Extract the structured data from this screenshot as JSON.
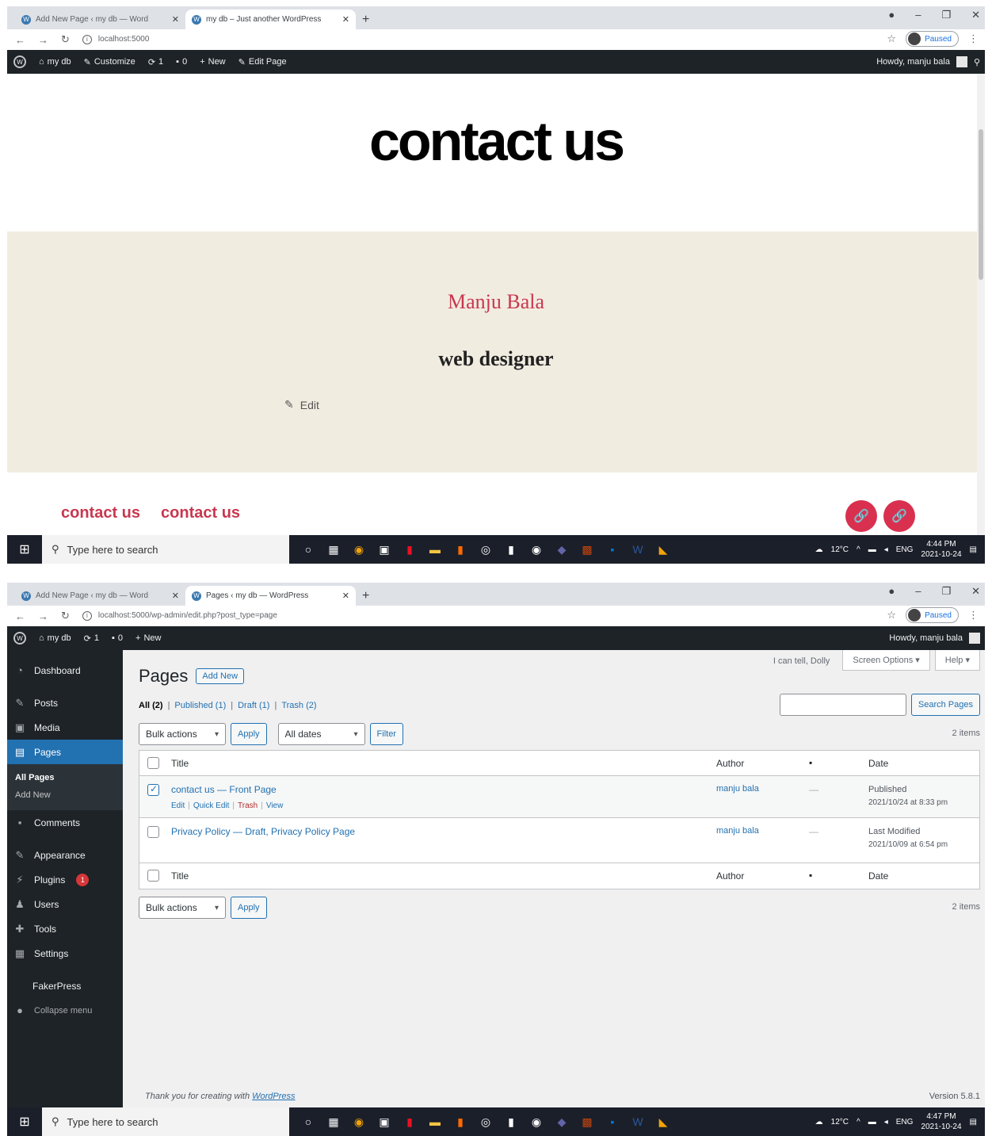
{
  "shot1": {
    "tabs": [
      {
        "label": "Add New Page ‹ my db — Word",
        "active": false
      },
      {
        "label": "my db – Just another WordPress",
        "active": true
      }
    ],
    "url": "localhost:5000",
    "profile_label": "Paused",
    "adminbar": {
      "site": "my db",
      "customize": "Customize",
      "updates": "1",
      "comments": "0",
      "new": "New",
      "edit_page": "Edit Page",
      "howdy": "Howdy, manju bala"
    },
    "page": {
      "title": "contact us",
      "name": "Manju Bala",
      "role": "web designer",
      "edit": "Edit",
      "footer_links": [
        "contact us",
        "contact us"
      ]
    }
  },
  "shot2": {
    "tabs": [
      {
        "label": "Add New Page ‹ my db — Word",
        "active": false
      },
      {
        "label": "Pages ‹ my db — WordPress",
        "active": true
      }
    ],
    "url": "localhost:5000/wp-admin/edit.php?post_type=page",
    "profile_label": "Paused",
    "adminbar": {
      "site": "my db",
      "updates": "1",
      "comments": "0",
      "new": "New",
      "howdy": "Howdy, manju bala"
    },
    "sidebar": {
      "dashboard": "Dashboard",
      "posts": "Posts",
      "media": "Media",
      "pages": "Pages",
      "all_pages": "All Pages",
      "add_new": "Add New",
      "comments": "Comments",
      "appearance": "Appearance",
      "plugins": "Plugins",
      "plugins_badge": "1",
      "users": "Users",
      "tools": "Tools",
      "settings": "Settings",
      "fakerpress": "FakerPress",
      "collapse": "Collapse menu"
    },
    "dolly": "I can tell, Dolly",
    "screen_options": "Screen Options ▾",
    "help": "Help ▾",
    "heading": "Pages",
    "add_new_btn": "Add New",
    "filters": {
      "all": "All (2)",
      "published": "Published (1)",
      "draft": "Draft (1)",
      "trash": "Trash (2)"
    },
    "search_btn": "Search Pages",
    "bulk_actions": "Bulk actions",
    "apply": "Apply",
    "all_dates": "All dates",
    "filter": "Filter",
    "items_count": "2 items",
    "columns": {
      "title": "Title",
      "author": "Author",
      "date": "Date"
    },
    "rows": [
      {
        "title": "contact us — Front Page",
        "author": "manju bala",
        "comments": "—",
        "status": "Published",
        "date": "2021/10/24 at 8:33 pm",
        "checked": true,
        "actions": [
          "Edit",
          "Quick Edit",
          "Trash",
          "View"
        ]
      },
      {
        "title": "Privacy Policy — Draft, Privacy Policy Page",
        "author": "manju bala",
        "comments": "—",
        "status": "Last Modified",
        "date": "2021/10/09 at 6:54 pm",
        "checked": false
      }
    ],
    "footer_thanks": "Thank you for creating with",
    "footer_link": "WordPress",
    "version": "Version 5.8.1"
  },
  "taskbar": {
    "search_placeholder": "Type here to search",
    "temp": "12°C",
    "lang": "ENG",
    "time1": "4:44 PM",
    "time2": "4:47 PM",
    "date": "2021-10-24"
  }
}
